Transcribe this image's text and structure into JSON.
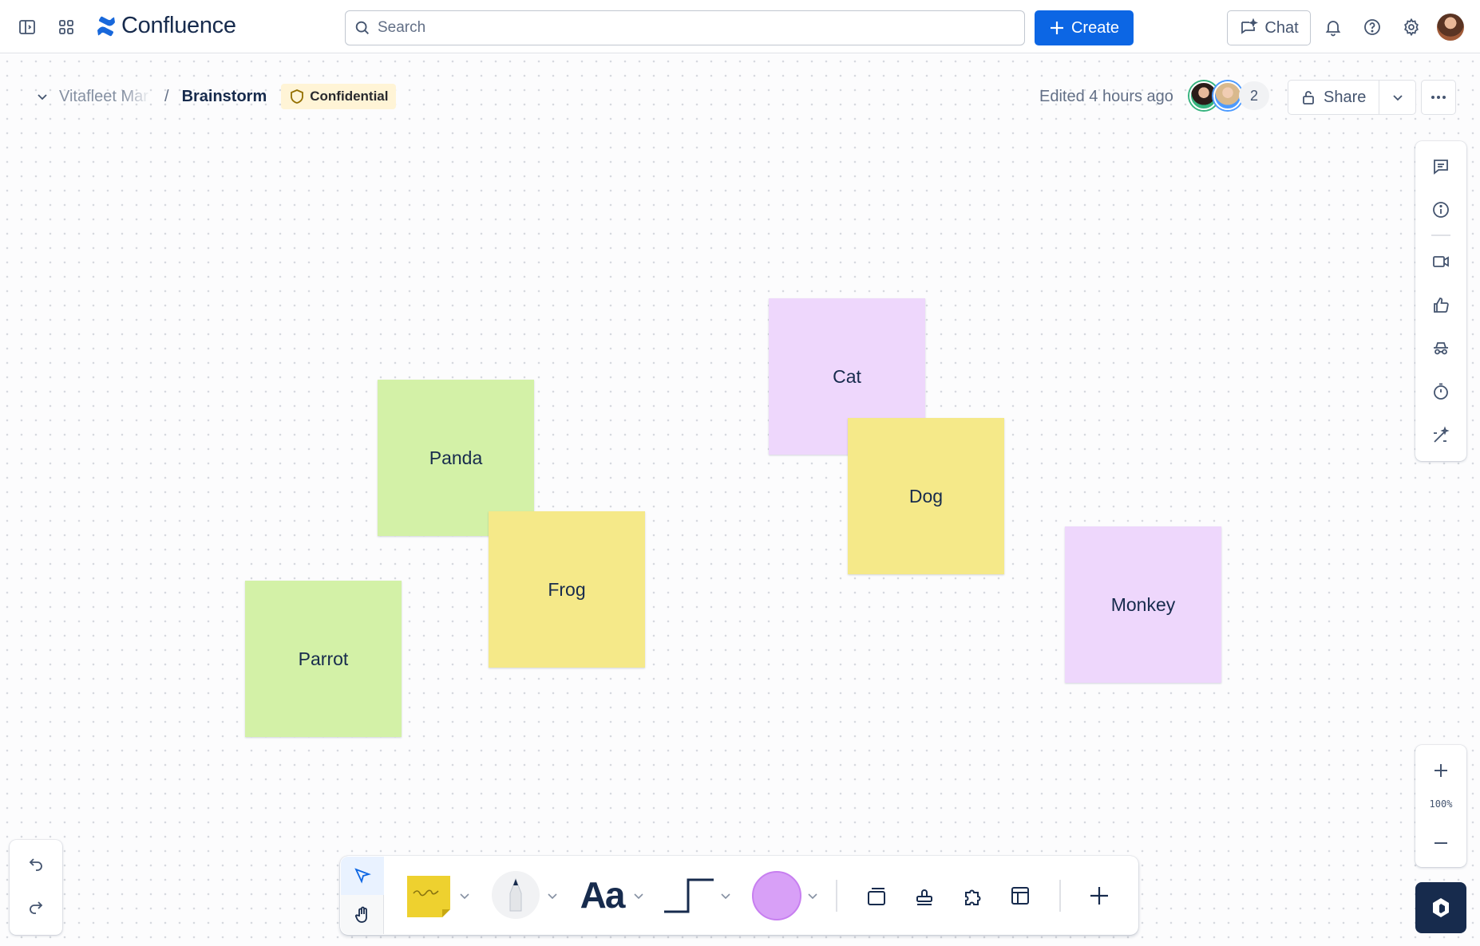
{
  "app": {
    "name": "Confluence"
  },
  "topbar": {
    "search_placeholder": "Search",
    "create_label": "Create",
    "chat_label": "Chat"
  },
  "breadcrumb": {
    "space": "Vitafleet Mar",
    "separator": "/",
    "page": "Brainstorm",
    "classification": "Confidential"
  },
  "page_meta": {
    "edited": "Edited 4 hours ago",
    "collaborator_count": "2",
    "share_label": "Share"
  },
  "colors": {
    "brand_blue": "#0c66e4",
    "sticky_green": "#d3f1a7",
    "sticky_yellow": "#f5e989",
    "sticky_purple": "#eed7fc",
    "badge_bg": "#fff4d6"
  },
  "stickies": [
    {
      "label": "Cat",
      "color": "purple"
    },
    {
      "label": "Panda",
      "color": "green"
    },
    {
      "label": "Dog",
      "color": "yellow"
    },
    {
      "label": "Frog",
      "color": "yellow"
    },
    {
      "label": "Parrot",
      "color": "green"
    },
    {
      "label": "Monkey",
      "color": "purple"
    }
  ],
  "zoom": {
    "level": "100%"
  },
  "toolbar": {
    "text_tool_glyph": "Aa",
    "tools": [
      "select-icon",
      "hand-icon",
      "sticky-note-icon",
      "pen-icon",
      "text-icon",
      "connector-icon",
      "shape-icon",
      "frame-icon",
      "stamp-icon",
      "puzzle-icon",
      "template-icon",
      "plus-icon"
    ]
  },
  "right_rail": [
    "comment-icon",
    "info-icon",
    "video-icon",
    "like-icon",
    "incognito-icon",
    "timer-icon",
    "magic-wand-icon"
  ]
}
